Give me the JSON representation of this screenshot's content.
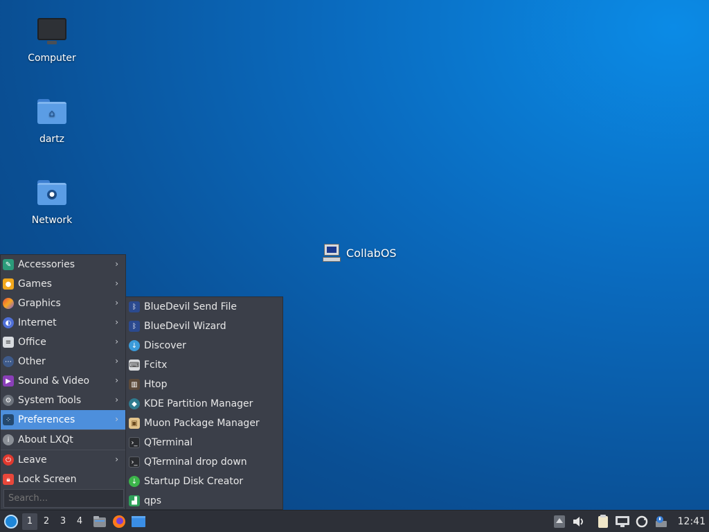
{
  "desktop": {
    "icons": [
      {
        "label": "Computer"
      },
      {
        "label": "dartz"
      },
      {
        "label": "Network"
      }
    ],
    "collab_label": "CollabOS"
  },
  "main_menu": {
    "items": [
      {
        "label": "Accessories"
      },
      {
        "label": "Games"
      },
      {
        "label": "Graphics"
      },
      {
        "label": "Internet"
      },
      {
        "label": "Office"
      },
      {
        "label": "Other"
      },
      {
        "label": "Sound & Video"
      },
      {
        "label": "System Tools"
      },
      {
        "label": "Preferences"
      },
      {
        "label": "About LXQt"
      },
      {
        "label": "Leave"
      },
      {
        "label": "Lock Screen"
      }
    ],
    "search_placeholder": "Search..."
  },
  "sub_menu": {
    "items": [
      {
        "label": "BlueDevil Send File"
      },
      {
        "label": "BlueDevil Wizard"
      },
      {
        "label": "Discover"
      },
      {
        "label": "Fcitx"
      },
      {
        "label": "Htop"
      },
      {
        "label": "KDE Partition Manager"
      },
      {
        "label": "Muon Package Manager"
      },
      {
        "label": "QTerminal"
      },
      {
        "label": "QTerminal drop down"
      },
      {
        "label": "Startup Disk Creator"
      },
      {
        "label": "qps"
      }
    ]
  },
  "taskbar": {
    "workspaces": [
      "1",
      "2",
      "3",
      "4"
    ],
    "clock": "12:41"
  },
  "colors": {
    "accent": "#4d8fdc",
    "menu_bg": "#3b3f49",
    "taskbar_bg": "#2d3038"
  }
}
